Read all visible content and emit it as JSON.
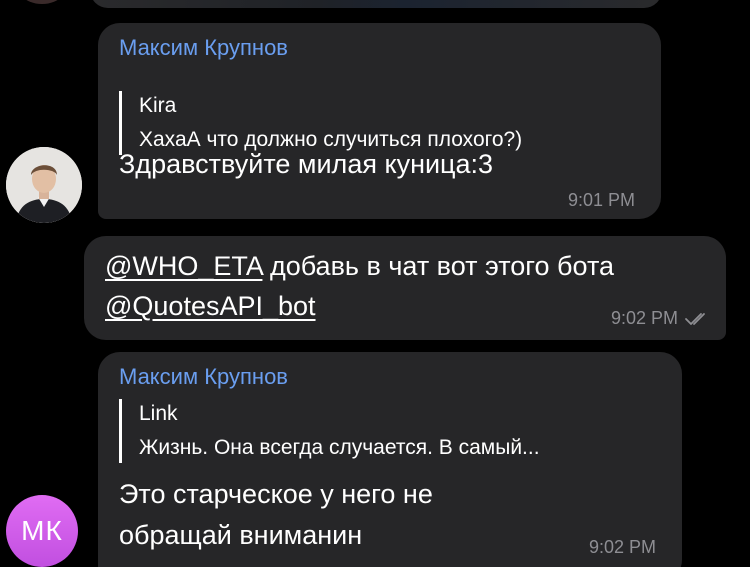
{
  "messages": {
    "msg1": {
      "sender": "Максим Крупнов",
      "reply_name": "Kira",
      "reply_text": "ХахаА что должно случиться плохого?)",
      "text": "Здравствуйте милая куница:3",
      "time": "9:01 PM"
    },
    "msg2": {
      "mention1": "@WHO_ETA",
      "text_line1": " добавь в чат вот этого бота",
      "mention2": "@QuotesAPI_bot",
      "time": "9:02 PM",
      "status_icon": "double-check-icon"
    },
    "msg3": {
      "sender": "Максим Крупнов",
      "reply_name": "Link",
      "reply_text": "Жизнь. Она всегда случается. В самый...",
      "text_line1": "Это старческое у него не",
      "text_line2": "обращай вниманин",
      "time": "9:02 PM"
    }
  },
  "avatars": {
    "photo_icon": "user-photo-avatar",
    "initials": "МК",
    "initials_color": "#c85ce8"
  },
  "colors": {
    "background": "#000000",
    "bubble": "#262628",
    "sender_name": "#6a9ef0",
    "timestamp": "#8e8e93"
  }
}
